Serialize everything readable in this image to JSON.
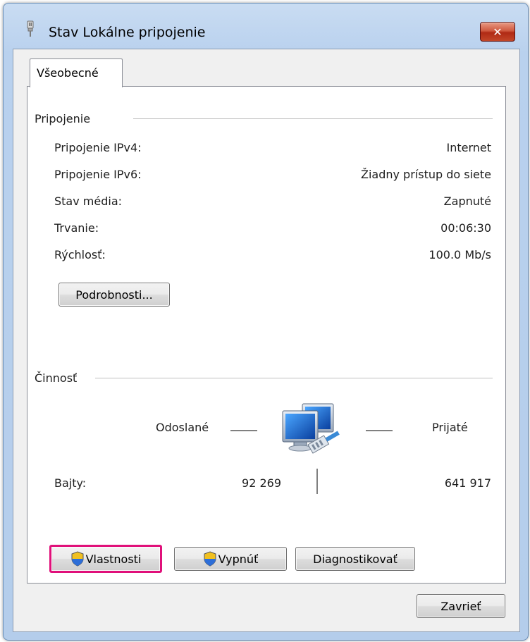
{
  "window": {
    "title": "Stav Lokálne pripojenie",
    "close_label": "✕"
  },
  "tabs": [
    {
      "label": "Všeobecné"
    }
  ],
  "connection": {
    "title": "Pripojenie",
    "rows": [
      {
        "label": "Pripojenie IPv4:",
        "value": "Internet"
      },
      {
        "label": "Pripojenie IPv6:",
        "value": "Žiadny prístup do siete"
      },
      {
        "label": "Stav média:",
        "value": "Zapnuté"
      },
      {
        "label": "Trvanie:",
        "value": "00:06:30"
      },
      {
        "label": "Rýchlosť:",
        "value": "100.0 Mb/s"
      }
    ],
    "details_button": "Podrobnosti..."
  },
  "activity": {
    "title": "Činnosť",
    "sent_label": "Odoslané",
    "received_label": "Prijaté",
    "bytes_label": "Bajty:",
    "bytes_sent": "92 269",
    "bytes_received": "641 917"
  },
  "buttons": {
    "properties": "Vlastnosti",
    "disable": "Vypnúť",
    "diagnose": "Diagnostikovať",
    "close": "Zavrieť"
  },
  "icons": {
    "title_icon": "network-cable-icon",
    "network_icon": "network-computers-icon",
    "shield_icon": "uac-shield-icon"
  },
  "colors": {
    "highlight": "#e0107a",
    "title_bar": "#b9d1ee"
  }
}
